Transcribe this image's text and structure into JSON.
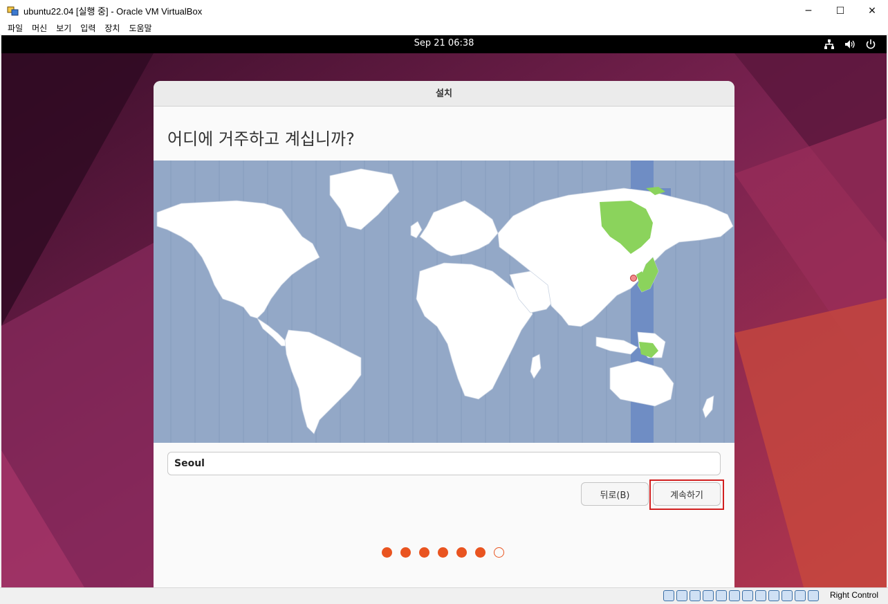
{
  "host_window": {
    "title": "ubuntu22.04 [실행 중] - Oracle VM VirtualBox",
    "controls": {
      "minimize": "─",
      "maximize": "☐",
      "close": "✕"
    },
    "menu": [
      "파일",
      "머신",
      "보기",
      "입력",
      "장치",
      "도움말"
    ]
  },
  "guest": {
    "topbar": {
      "clock": "Sep 21  06:38"
    },
    "installer": {
      "window_title": "설치",
      "heading": "어디에 거주하고 계십니까?",
      "timezone_value": "Seoul",
      "back_label": "뒤로(B)",
      "continue_label": "계속하기",
      "progress": {
        "steps": 7,
        "current": 6
      }
    }
  },
  "status_bar": {
    "host_key": "Right Control",
    "icons": [
      "hard-disk-icon",
      "optical-drive-icon",
      "audio-icon",
      "network-icon",
      "usb-icon",
      "shared-folder-icon",
      "display-icon",
      "recording-icon",
      "cpu-icon",
      "guest-additions-icon",
      "mouse-integration-icon",
      "keyboard-capture-icon"
    ]
  },
  "colors": {
    "accent": "#e95420",
    "map_ocean": "#93a8c7",
    "map_land": "#ffffff",
    "map_selected_zone": "#8bd35c",
    "map_zone_band": "#6f8dc4"
  }
}
